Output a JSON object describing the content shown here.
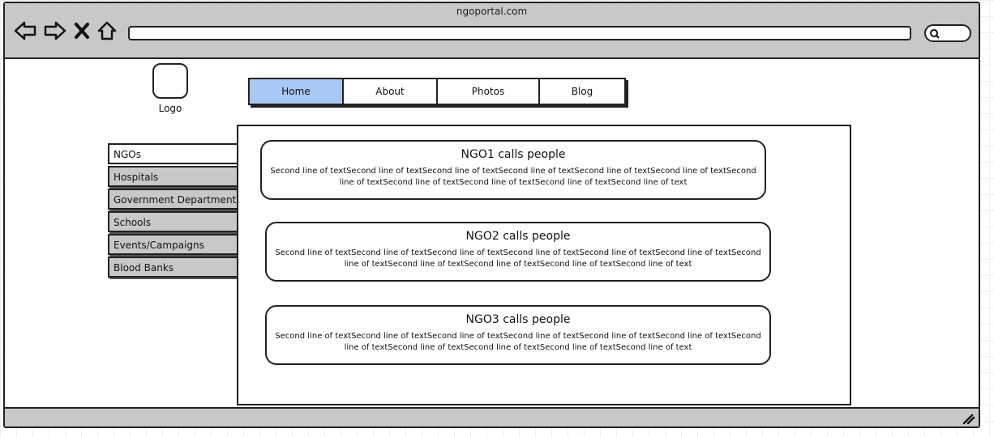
{
  "browser": {
    "title": "ngoportal.com",
    "address_value": "",
    "icons": [
      "back-arrow-icon",
      "forward-arrow-icon",
      "close-x-icon",
      "home-icon",
      "search-icon",
      "resize-grip-icon"
    ]
  },
  "header": {
    "logo_label": "Logo",
    "nav_tabs": [
      {
        "label": "Home",
        "active": true
      },
      {
        "label": "About",
        "active": false
      },
      {
        "label": "Photos",
        "active": false
      },
      {
        "label": "Blog",
        "active": false
      }
    ]
  },
  "sidebar": {
    "items": [
      {
        "label": "NGOs",
        "active": true
      },
      {
        "label": "Hospitals",
        "active": false
      },
      {
        "label": "Government Departments",
        "active": false
      },
      {
        "label": "Schools",
        "active": false
      },
      {
        "label": "Events/Campaigns",
        "active": false
      },
      {
        "label": "Blood Banks",
        "active": false
      }
    ]
  },
  "main": {
    "cards": [
      {
        "title": "NGO1 calls people",
        "body": "Second line of textSecond line of textSecond line of textSecond line of textSecond line of textSecond line of textSecond line of textSecond line of textSecond line of textSecond line of textSecond line of text"
      },
      {
        "title": "NGO2 calls people",
        "body": "Second line of textSecond line of textSecond line of textSecond line of textSecond line of textSecond line of textSecond line of textSecond line of textSecond line of textSecond line of textSecond line of text"
      },
      {
        "title": "NGO3 calls people",
        "body": "Second line of textSecond line of textSecond line of textSecond line of textSecond line of textSecond line of textSecond line of textSecond line of textSecond line of textSecond line of textSecond line of text"
      }
    ]
  },
  "colors": {
    "chrome_gray": "#c8c8c8",
    "active_tab": "#a9c7f3",
    "stroke": "#222222"
  }
}
